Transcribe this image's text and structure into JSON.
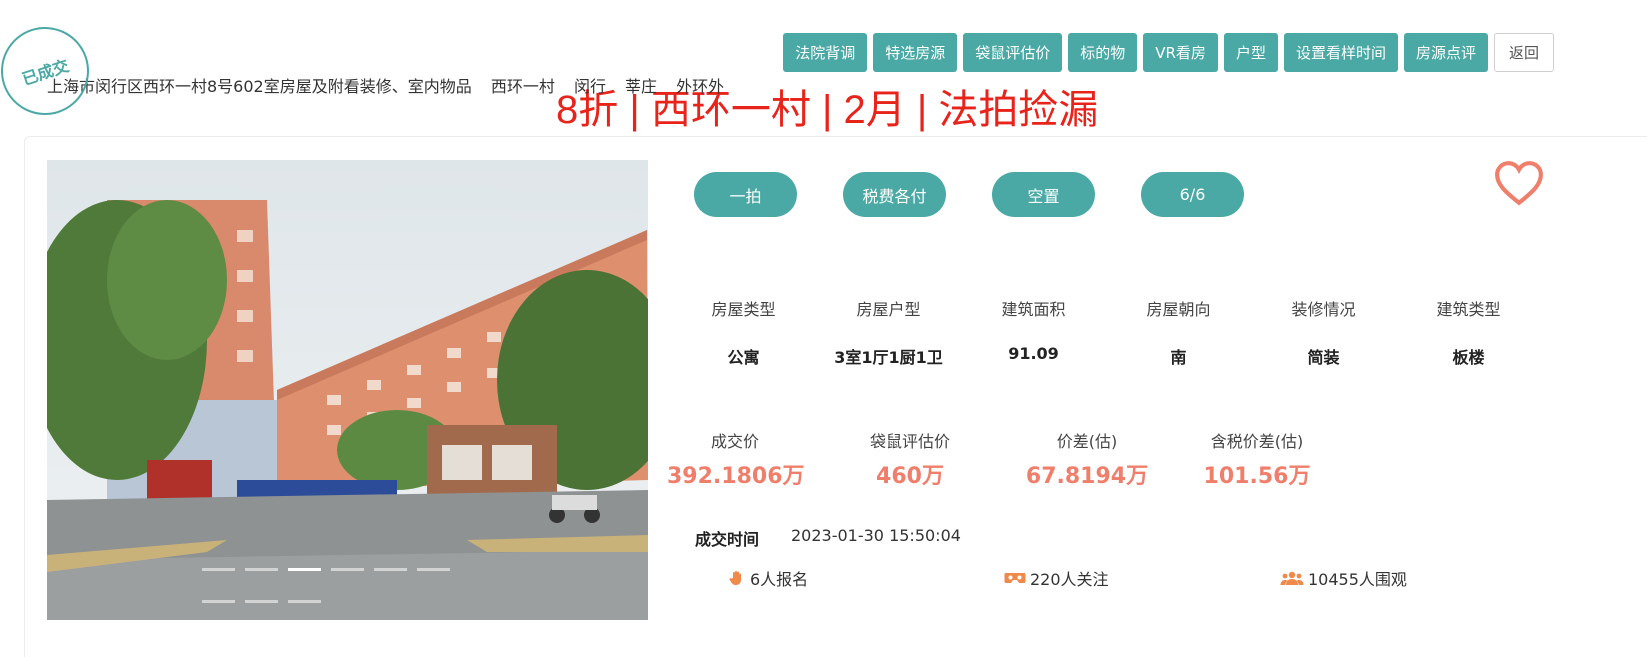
{
  "stamp": "已成交",
  "address": {
    "full": "上海市闵行区西环一村8号602室房屋及附看装修、室内物品",
    "community": "西环一村",
    "district": "闵行",
    "town": "莘庄",
    "ring": "外环外"
  },
  "headline": "8折 | 西环一村 | 2月 | 法拍捡漏",
  "nav": {
    "items": [
      "法院背调",
      "特选房源",
      "袋鼠评估价",
      "标的物",
      "VR看房",
      "户型",
      "设置看样时间",
      "房源点评"
    ],
    "back": "返回"
  },
  "tags": [
    "一拍",
    "税费各付",
    "空置",
    "6/6"
  ],
  "info": {
    "labels": [
      "房屋类型",
      "房屋户型",
      "建筑面积",
      "房屋朝向",
      "装修情况",
      "建筑类型"
    ],
    "values": [
      "公寓",
      "3室1厅1厨1卫",
      "91.09",
      "南",
      "简装",
      "板楼"
    ]
  },
  "prices": [
    {
      "label": "成交价",
      "value": "392.1806万"
    },
    {
      "label": "袋鼠评估价",
      "value": "460万"
    },
    {
      "label": "价差(估)",
      "value": "67.8194万"
    },
    {
      "label": "含税价差(估)",
      "value": "101.56万"
    }
  ],
  "deal": {
    "label": "成交时间",
    "time": "2023-01-30 15:50:04"
  },
  "stats": {
    "signups": "6人报名",
    "followers": "220人关注",
    "watchers": "10455人围观"
  },
  "colors": {
    "accent": "#4aa9a4",
    "headline": "#e8231a",
    "price": "#ef7f6a"
  }
}
